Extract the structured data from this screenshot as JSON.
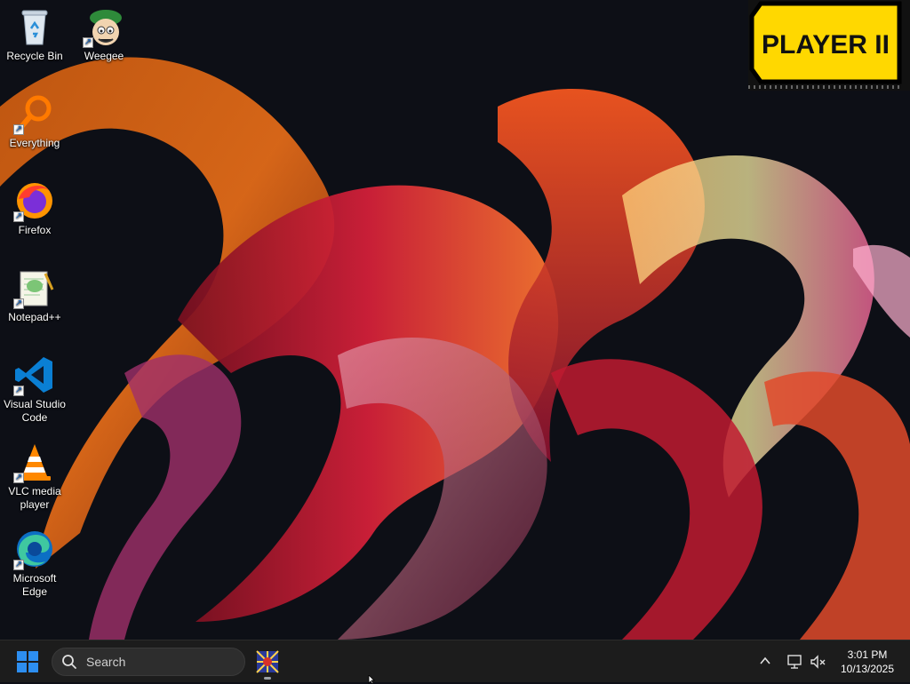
{
  "desktop": {
    "icons": [
      {
        "label": "Recycle Bin",
        "icon": "recycle-bin-icon"
      },
      {
        "label": "Weegee",
        "icon": "weegee-icon"
      },
      {
        "label": "Everything",
        "icon": "everything-search-icon"
      },
      {
        "label": "Firefox",
        "icon": "firefox-icon"
      },
      {
        "label": "Notepad++",
        "icon": "notepadpp-icon"
      },
      {
        "label": "Visual Studio Code",
        "icon": "vscode-icon"
      },
      {
        "label": "VLC media player",
        "icon": "vlc-icon"
      },
      {
        "label": "Microsoft Edge",
        "icon": "edge-icon"
      }
    ],
    "badge_text": "PLAYER II"
  },
  "taskbar": {
    "search_placeholder": "Search",
    "time": "3:01 PM",
    "date": "10/13/2025"
  },
  "colors": {
    "taskbar_bg": "#1c1c1c",
    "wallpaper_bg": "#0d0f16",
    "accent_blue": "#0078d4"
  }
}
